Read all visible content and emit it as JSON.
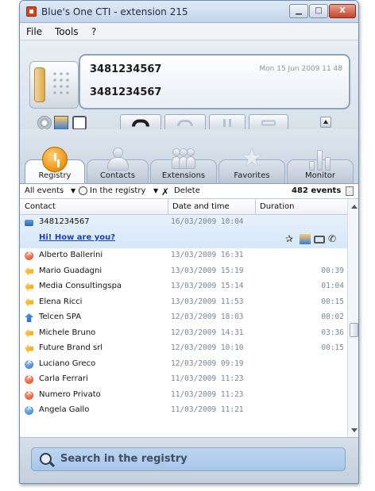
{
  "window": {
    "title": "Blue's One CTI - extension 215",
    "buttons": {
      "minimize": "▁",
      "maximize": "□",
      "close": "X"
    }
  },
  "menu": {
    "items": [
      "File",
      "Tools",
      "?"
    ]
  },
  "phone": {
    "number_line1": "3481234567",
    "number_line2": "3481234567",
    "datetime": "Mon 15 Jun 2009  11 48"
  },
  "tabs": [
    {
      "label": "Registry",
      "icon": "clock-icon",
      "active": true
    },
    {
      "label": "Contacts",
      "icon": "person-icon"
    },
    {
      "label": "Extensions",
      "icon": "group-icon"
    },
    {
      "label": "Favorites",
      "icon": "star-icon"
    },
    {
      "label": "Monitor",
      "icon": "bars-icon"
    }
  ],
  "filter": {
    "events_dropdown": "All events",
    "scope_dropdown": "In the registry",
    "delete_label": "Delete",
    "count": "482 events"
  },
  "table": {
    "columns": [
      "Contact",
      "Date and time",
      "Duration"
    ],
    "selected": {
      "contact": "3481234567",
      "date": "16/03/2009 10:04",
      "message": "Hi! How are you?"
    },
    "rows": [
      {
        "contact": "Alberto Ballerini",
        "date": "13/03/2009 16:31",
        "duration": "",
        "status": "missed"
      },
      {
        "contact": "Mario Guadagni",
        "date": "13/03/2009 15:19",
        "duration": "00:39",
        "status": "incoming"
      },
      {
        "contact": "Media Consultingspa",
        "date": "13/03/2009 15:14",
        "duration": "01:04",
        "status": "incoming"
      },
      {
        "contact": "Elena Ricci",
        "date": "13/03/2009 11:53",
        "duration": "00:15",
        "status": "incoming"
      },
      {
        "contact": "Telcen SPA",
        "date": "12/03/2009 18:03",
        "duration": "00:02",
        "status": "outgoing"
      },
      {
        "contact": "Michele Bruno",
        "date": "12/03/2009 14:31",
        "duration": "03:36",
        "status": "incoming"
      },
      {
        "contact": "Future Brand srl",
        "date": "12/03/2009 10:10",
        "duration": "00:15",
        "status": "incoming"
      },
      {
        "contact": "Luciano Greco",
        "date": "12/03/2009 09:19",
        "duration": "",
        "status": "unanswered"
      },
      {
        "contact": "Carla Ferrari",
        "date": "11/03/2009 11:23",
        "duration": "",
        "status": "missed"
      },
      {
        "contact": "Numero Privato",
        "date": "11/03/2009 11:23",
        "duration": "",
        "status": "missed"
      },
      {
        "contact": "Angela Gallo",
        "date": "11/03/2009 11:21",
        "duration": "",
        "status": "unanswered"
      }
    ]
  },
  "search": {
    "placeholder": "Search in the registry"
  },
  "colors": {
    "accent": "#f29a1a",
    "selection": "#d6e7f7",
    "link": "#1a3fb8"
  }
}
